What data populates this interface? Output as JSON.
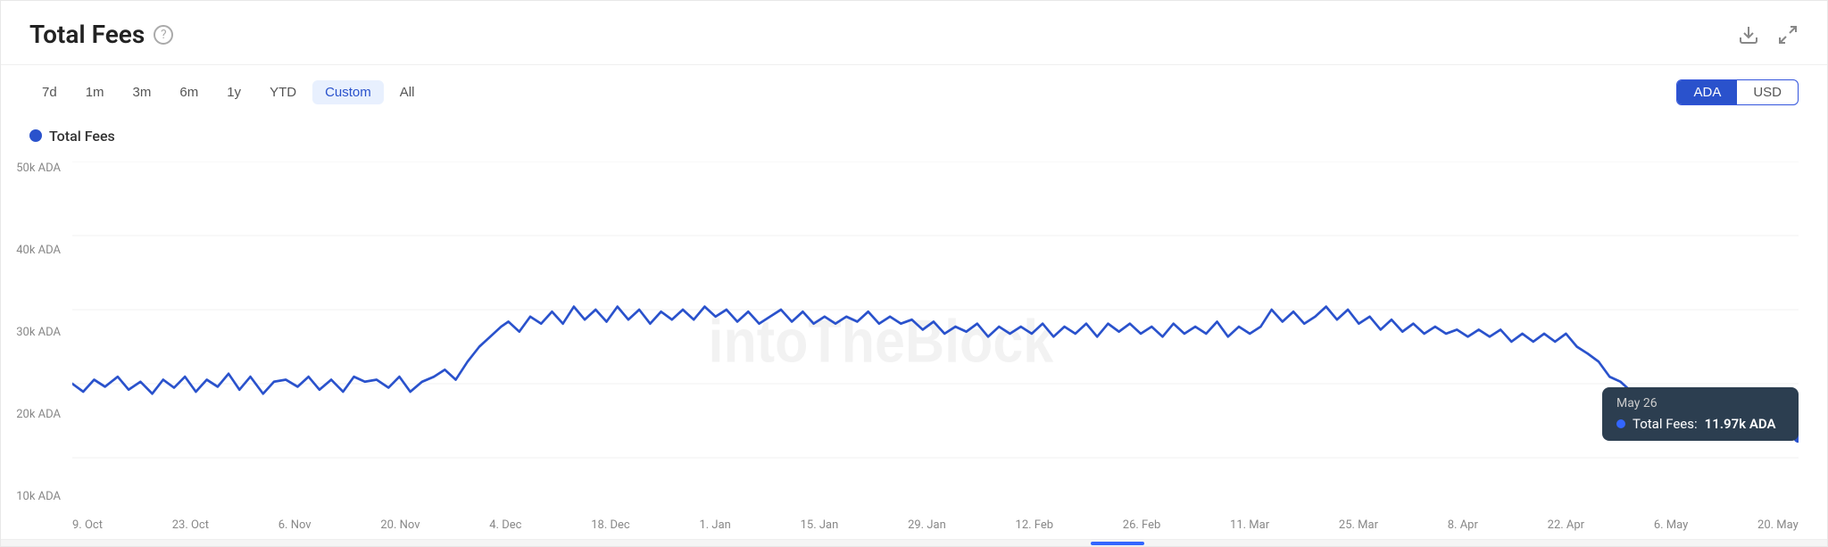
{
  "header": {
    "title": "Total Fees",
    "info_icon": "?",
    "download_icon": "⬇",
    "expand_icon": "⛶"
  },
  "time_filters": [
    {
      "label": "7d",
      "active": false
    },
    {
      "label": "1m",
      "active": false
    },
    {
      "label": "3m",
      "active": false
    },
    {
      "label": "6m",
      "active": false
    },
    {
      "label": "1y",
      "active": false
    },
    {
      "label": "YTD",
      "active": false
    },
    {
      "label": "Custom",
      "active": true
    },
    {
      "label": "All",
      "active": false
    }
  ],
  "currency": {
    "options": [
      "ADA",
      "USD"
    ],
    "active": "ADA"
  },
  "legend": {
    "label": "Total Fees"
  },
  "y_axis": {
    "labels": [
      "50k ADA",
      "40k ADA",
      "30k ADA",
      "20k ADA",
      "10k ADA"
    ]
  },
  "x_axis": {
    "labels": [
      "9. Oct",
      "23. Oct",
      "6. Nov",
      "20. Nov",
      "4. Dec",
      "18. Dec",
      "1. Jan",
      "15. Jan",
      "29. Jan",
      "12. Feb",
      "26. Feb",
      "11. Mar",
      "25. Mar",
      "8. Apr",
      "22. Apr",
      "6. May",
      "20. May"
    ]
  },
  "tooltip": {
    "date": "May 26",
    "label": "Total Fees:",
    "value": "11.97k ADA"
  },
  "watermark": "intoTheBlock"
}
